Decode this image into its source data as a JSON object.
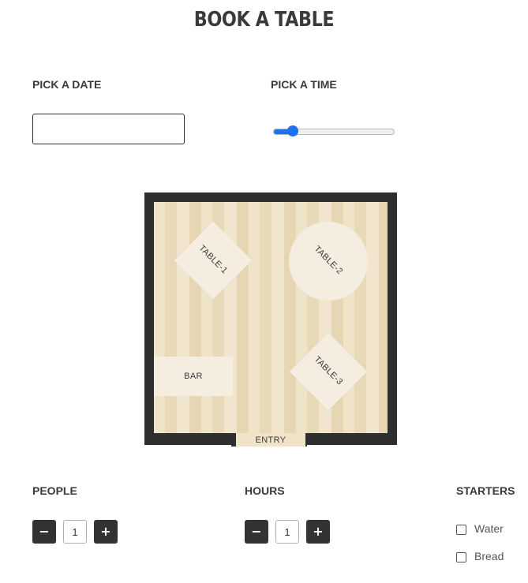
{
  "page": {
    "title": "BOOK A TABLE"
  },
  "date": {
    "label": "PICK A DATE",
    "value": ""
  },
  "time": {
    "label": "PICK A TIME",
    "slider_position": 0.13
  },
  "floor_plan": {
    "tables": [
      {
        "label": "TABLE-1",
        "shape": "square"
      },
      {
        "label": "TABLE-2",
        "shape": "round"
      },
      {
        "label": "TABLE-3",
        "shape": "square"
      }
    ],
    "bar_label": "BAR",
    "entry_label": "ENTRY"
  },
  "people": {
    "label": "PEOPLE",
    "minus": "−",
    "plus": "+",
    "value": "1"
  },
  "hours": {
    "label": "HOURS",
    "minus": "−",
    "plus": "+",
    "value": "1"
  },
  "starters": {
    "label": "STARTERS",
    "options": [
      {
        "label": "Water",
        "checked": false
      },
      {
        "label": "Bread",
        "checked": false
      }
    ]
  },
  "colors": {
    "accent": "#1a73e8",
    "dark": "#333333",
    "wood": "#efe3c8",
    "table": "#f5eee0"
  }
}
